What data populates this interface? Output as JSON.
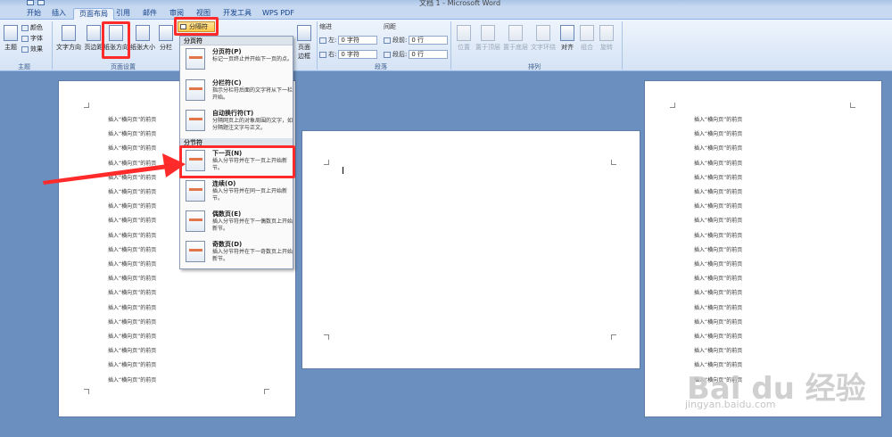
{
  "window": {
    "title": "文档 1 - Microsoft Word"
  },
  "tabs": [
    "开始",
    "插入",
    "页面布局",
    "引用",
    "邮件",
    "审阅",
    "视图",
    "开发工具",
    "WPS PDF"
  ],
  "active_tab": "页面布局",
  "ribbon": {
    "theme_group": {
      "label": "主题",
      "theme_btn": "主题",
      "colors": "颜色",
      "fonts": "字体",
      "effects": "效果"
    },
    "page_setup_group": {
      "label": "页面设置",
      "text_direction": "文字方向",
      "margins": "页边距",
      "orientation": "纸张方向",
      "size": "纸张大小",
      "columns": "分栏",
      "breaks": "分隔符"
    },
    "page_bg": {
      "borders": "页面",
      "borders2": "边框"
    },
    "paragraph_group": {
      "label": "段落",
      "indent": "缩进",
      "spacing": "间距",
      "left_label": "左:",
      "left_value": "0 字符",
      "right_label": "右:",
      "right_value": "0 字符",
      "before_label": "段前:",
      "before_value": "0 行",
      "after_label": "段后:",
      "after_value": "0 行"
    },
    "arrange_group": {
      "label": "排列",
      "position": "位置",
      "bring_front": "置于顶层",
      "send_back": "置于底层",
      "wrap": "文字环绕",
      "align": "对齐",
      "group": "组合",
      "rotate": "旋转"
    }
  },
  "menu": {
    "section_page_breaks": "分页符",
    "section_section_breaks": "分节符",
    "items": [
      {
        "title": "分页符(P)",
        "desc": "标记一页终止并开始下一页的点。"
      },
      {
        "title": "分栏符(C)",
        "desc": "指示分栏符后面的文字将从下一栏开始。"
      },
      {
        "title": "自动换行符(T)",
        "desc": "分隔网页上的对象周围的文字，如分隔题注文字与正文。"
      },
      {
        "title": "下一页(N)",
        "desc": "插入分节符并在下一页上开始新节。"
      },
      {
        "title": "连续(O)",
        "desc": "插入分节符并在同一页上开始新节。"
      },
      {
        "title": "偶数页(E)",
        "desc": "插入分节符并在下一偶数页上开始新节。"
      },
      {
        "title": "奇数页(D)",
        "desc": "插入分节符并在下一奇数页上开始新节。"
      }
    ]
  },
  "document": {
    "line_text": "插入“横向页”的前页"
  },
  "watermark": {
    "brand": "Bai du 经验",
    "url": "jingyan.baidu.com"
  },
  "colors": {
    "highlight": "#ff2a2a",
    "ribbon_bg": "#d5e3f5",
    "workspace": "#6b8fbf"
  }
}
